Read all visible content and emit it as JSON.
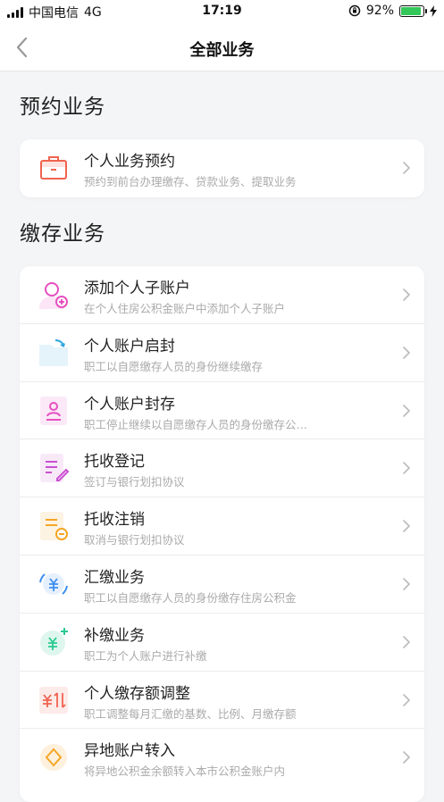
{
  "status": {
    "carrier": "中国电信",
    "network": "4G",
    "time": "17:19",
    "battery": "92%",
    "battery_level": 0.92
  },
  "nav": {
    "title": "全部业务"
  },
  "sections": [
    {
      "title": "预约业务",
      "items": [
        {
          "title": "个人业务预约",
          "sub": "预约到前台办理缴存、贷款业务、提取业务",
          "icon": "briefcase-icon",
          "color": "#f0624f"
        }
      ]
    },
    {
      "title": "缴存业务",
      "items": [
        {
          "title": "添加个人子账户",
          "sub": "在个人住房公积金账户中添加个人子账户",
          "icon": "add-user-icon",
          "color": "#e64fc0"
        },
        {
          "title": "个人账户启封",
          "sub": "职工以自愿缴存人员的身份继续缴存",
          "icon": "open-folder-icon",
          "color": "#2fa7e0"
        },
        {
          "title": "个人账户封存",
          "sub": "职工停止继续以自愿缴存人员的身份缴存公…",
          "icon": "sealed-profile-icon",
          "color": "#e64fc0"
        },
        {
          "title": "托收登记",
          "sub": "签订与银行划扣协议",
          "icon": "document-edit-icon",
          "color": "#c94fd0"
        },
        {
          "title": "托收注销",
          "sub": "取消与银行划扣协议",
          "icon": "document-cancel-icon",
          "color": "#f5a623"
        },
        {
          "title": "汇缴业务",
          "sub": "职工以自愿缴存人员的身份缴存住房公积金",
          "icon": "yuan-cycle-icon",
          "color": "#3b8ef0"
        },
        {
          "title": "补缴业务",
          "sub": "职工为个人账户进行补缴",
          "icon": "yuan-plus-icon",
          "color": "#2cc98f"
        },
        {
          "title": "个人缴存额调整",
          "sub": "职工调整每月汇缴的基数、比例、月缴存额",
          "icon": "yuan-adjust-icon",
          "color": "#f0624f"
        },
        {
          "title": "异地账户转入",
          "sub": "将异地公积金余额转入本市公积金账户内",
          "icon": "transfer-in-icon",
          "color": "#f5a623"
        }
      ]
    }
  ]
}
